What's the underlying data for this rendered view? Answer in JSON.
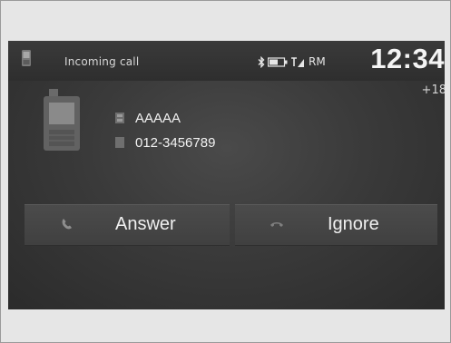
{
  "status_bar": {
    "title": "Incoming call",
    "network": "RM",
    "clock": "12:34"
  },
  "temperature": "18",
  "caller": {
    "name": "AAAAA",
    "number": "012-3456789"
  },
  "buttons": {
    "answer_label": "Answer",
    "ignore_label": "Ignore"
  },
  "icons": {
    "status_phone": "phone-icon",
    "bluetooth": "bluetooth-icon",
    "battery": "battery-icon",
    "signal": "signal-icon",
    "caller_phone": "mobile-phone-icon",
    "name": "contact-icon",
    "number": "phone-number-icon",
    "answer": "answer-call-icon",
    "ignore": "ignore-call-icon"
  },
  "colors": {
    "screen_bg": "#3a3a3a",
    "text": "#f2f2f2",
    "button_bg": "#474747"
  }
}
